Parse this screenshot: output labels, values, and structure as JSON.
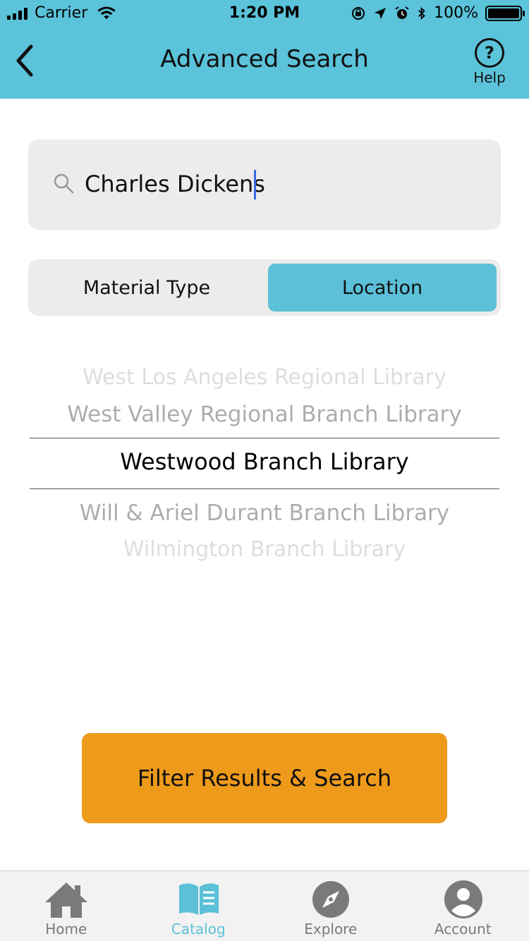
{
  "status_bar": {
    "carrier": "Carrier",
    "time": "1:20 PM",
    "battery": "100%"
  },
  "header": {
    "title": "Advanced Search",
    "help_label": "Help"
  },
  "search": {
    "value": "Charles Dickens",
    "placeholder": ""
  },
  "segment": {
    "items": [
      "Material Type",
      "Location"
    ],
    "selected": "Location"
  },
  "picker": {
    "items": [
      "West Los Angeles Regional Library",
      "West Valley Regional Branch Library",
      "Westwood Branch Library",
      "Will & Ariel Durant Branch Library",
      "Wilmington Branch Library"
    ],
    "selected": "Westwood Branch Library"
  },
  "actions": {
    "filter_label": "Filter Results & Search"
  },
  "tabbar": {
    "items": [
      {
        "label": "Home",
        "icon": "home-icon"
      },
      {
        "label": "Catalog",
        "icon": "catalog-book-icon"
      },
      {
        "label": "Explore",
        "icon": "compass-icon"
      },
      {
        "label": "Account",
        "icon": "account-icon"
      }
    ],
    "active": "Catalog"
  },
  "colors": {
    "header": "#5bc3da",
    "accent": "#5bc0d8",
    "button": "#ee9a1b",
    "field_bg": "#ececec"
  }
}
